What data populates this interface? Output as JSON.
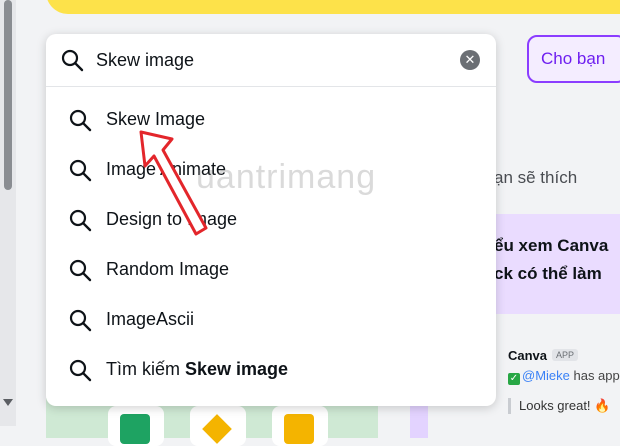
{
  "search": {
    "query": "Skew image",
    "clear_icon": "close-icon"
  },
  "results": [
    {
      "icon": "search-icon",
      "label": "Skew Image"
    },
    {
      "icon": "search-icon",
      "label": "Image Animate"
    },
    {
      "icon": "search-icon",
      "label": "Design to Image"
    },
    {
      "icon": "search-icon",
      "label": "Random Image"
    },
    {
      "icon": "search-icon",
      "label": "ImageAscii"
    }
  ],
  "search_all": {
    "prefix": "Tìm kiếm ",
    "query": "Skew image"
  },
  "tab": {
    "label": "Cho bạn"
  },
  "side": {
    "recommend_text": "ạn sẽ thích",
    "promo_line1": "ểu xem Canva",
    "promo_line2": "ck có thể làm"
  },
  "comment": {
    "author": "Canva",
    "badge": "APP",
    "mention": "@Mieke",
    "text": " has appr",
    "quote": "Looks great!"
  },
  "watermark": "uantrimang",
  "colors": {
    "banner": "#fde24a",
    "accent": "#8b3dff",
    "arrow": "#e3262b"
  }
}
